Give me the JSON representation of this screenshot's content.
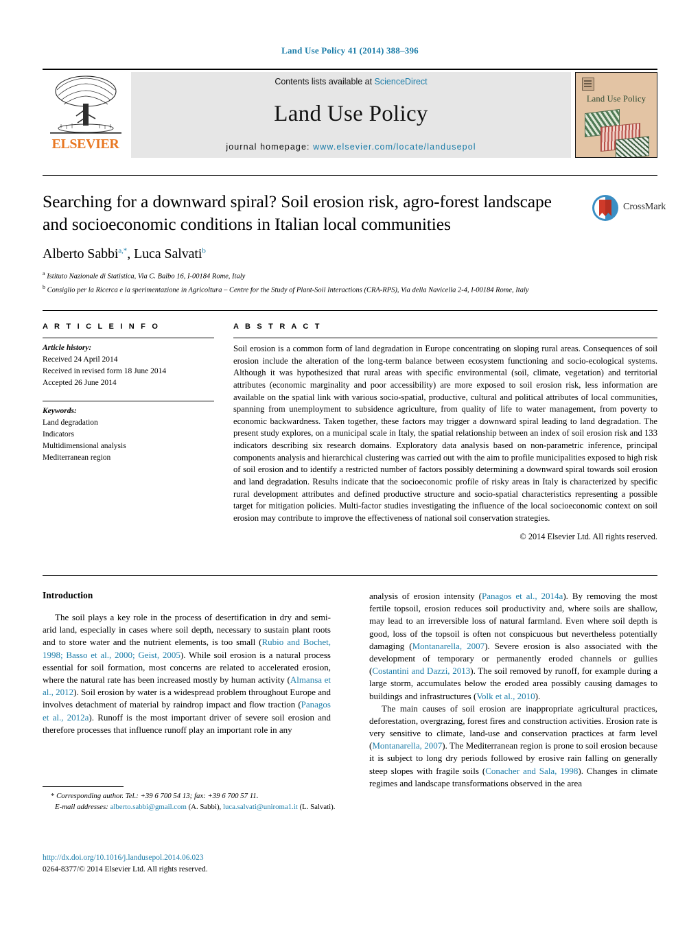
{
  "running_head": "Land Use Policy 41 (2014) 388–396",
  "masthead": {
    "publisher": "ELSEVIER",
    "contents_prefix": "Contents lists available at ",
    "contents_link": "ScienceDirect",
    "journal_name": "Land Use Policy",
    "homepage_prefix": "journal homepage: ",
    "homepage_url": "www.elsevier.com/locate/landusepol",
    "cover_title": "Land Use Policy"
  },
  "article": {
    "title": "Searching for a downward spiral? Soil erosion risk, agro-forest landscape and socioeconomic conditions in Italian local communities",
    "authors_html": "Alberto Sabbi<sup>a,*</sup>, Luca Salvati<sup>b</sup>",
    "affiliation_a": "Istituto Nazionale di Statistica, Via C. Balbo 16, I-00184 Rome, Italy",
    "affiliation_b": "Consiglio per la Ricerca e la sperimentazione in Agricoltura – Centre for the Study of Plant-Soil Interactions (CRA-RPS), Via della Navicella 2-4, I-00184 Rome, Italy",
    "crossmark_label": "CrossMark"
  },
  "article_info": {
    "heading": "A R T I C L E   I N F O",
    "history_label": "Article history:",
    "history": [
      "Received 24 April 2014",
      "Received in revised form 18 June 2014",
      "Accepted 26 June 2014"
    ],
    "keywords_label": "Keywords:",
    "keywords": [
      "Land degradation",
      "Indicators",
      "Multidimensional analysis",
      "Mediterranean region"
    ]
  },
  "abstract": {
    "heading": "A B S T R A C T",
    "text": "Soil erosion is a common form of land degradation in Europe concentrating on sloping rural areas. Consequences of soil erosion include the alteration of the long-term balance between ecosystem functioning and socio-ecological systems. Although it was hypothesized that rural areas with specific environmental (soil, climate, vegetation) and territorial attributes (economic marginality and poor accessibility) are more exposed to soil erosion risk, less information are available on the spatial link with various socio-spatial, productive, cultural and political attributes of local communities, spanning from unemployment to subsidence agriculture, from quality of life to water management, from poverty to economic backwardness. Taken together, these factors may trigger a downward spiral leading to land degradation. The present study explores, on a municipal scale in Italy, the spatial relationship between an index of soil erosion risk and 133 indicators describing six research domains. Exploratory data analysis based on non-parametric inference, principal components analysis and hierarchical clustering was carried out with the aim to profile municipalities exposed to high risk of soil erosion and to identify a restricted number of factors possibly determining a downward spiral towards soil erosion and land degradation. Results indicate that the socioeconomic profile of risky areas in Italy is characterized by specific rural development attributes and defined productive structure and socio-spatial characteristics representing a possible target for mitigation policies. Multi-factor studies investigating the influence of the local socioeconomic context on soil erosion may contribute to improve the effectiveness of national soil conservation strategies.",
    "copyright": "© 2014 Elsevier Ltd. All rights reserved."
  },
  "introduction": {
    "heading": "Introduction",
    "left_p1_html": "The soil plays a key role in the process of desertification in dry and semi-arid land, especially in cases where soil depth, necessary to sustain plant roots and to store water and the nutrient elements, is too small (<span class=\"cite\">Rubio and Bochet, 1998; Basso et al., 2000; Geist, 2005</span>). While soil erosion is a natural process essential for soil formation, most concerns are related to accelerated erosion, where the natural rate has been increased mostly by human activity (<span class=\"cite\">Almansa et al., 2012</span>). Soil erosion by water is a widespread problem throughout Europe and involves detachment of material by raindrop impact and flow traction (<span class=\"cite\">Panagos et al., 2012a</span>). Runoff is the most important driver of severe soil erosion and therefore processes that influence runoff play an important role in any",
    "right_p1_html": "analysis of erosion intensity (<span class=\"cite\">Panagos et al., 2014a</span>). By removing the most fertile topsoil, erosion reduces soil productivity and, where soils are shallow, may lead to an irreversible loss of natural farmland. Even where soil depth is good, loss of the topsoil is often not conspicuous but nevertheless potentially damaging (<span class=\"cite\">Montanarella, 2007</span>). Severe erosion is also associated with the development of temporary or permanently eroded channels or gullies (<span class=\"cite\">Costantini and Dazzi, 2013</span>). The soil removed by runoff, for example during a large storm, accumulates below the eroded area possibly causing damages to buildings and infrastructures (<span class=\"cite\">Volk et al., 2010</span>).",
    "right_p2_html": "The main causes of soil erosion are inappropriate agricultural practices, deforestation, overgrazing, forest fires and construction activities. Erosion rate is very sensitive to climate, land-use and conservation practices at farm level (<span class=\"cite\">Montanarella, 2007</span>). The Mediterranean region is prone to soil erosion because it is subject to long dry periods followed by erosive rain falling on generally steep slopes with fragile soils (<span class=\"cite\">Conacher and Sala, 1998</span>). Changes in climate regimes and landscape transformations observed in the area"
  },
  "footer": {
    "corresponding_html": "* <span class=\"it\">Corresponding author. Tel.: +39 6 700 54 13; fax: +39 6 700 57 11.</span>",
    "emails_html": "<span class=\"it\">E-mail addresses:</span> <span class=\"cite\">alberto.sabbi@gmail.com</span> (A. Sabbi), <span class=\"cite\">luca.salvati@uniroma1.it</span> (L. Salvati).",
    "doi": "http://dx.doi.org/10.1016/j.landusepol.2014.06.023",
    "issn_line": "0264-8377/© 2014 Elsevier Ltd. All rights reserved."
  },
  "colors": {
    "link": "#1b7ca8",
    "elsevier_orange": "#E87722",
    "masthead_bg": "#e6e6e6",
    "cover_bg": "#e3c4a4"
  }
}
